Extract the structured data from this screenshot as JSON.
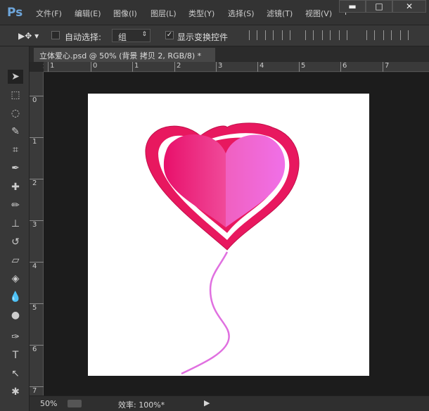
{
  "app": {
    "logo": "Ps"
  },
  "menu": [
    "文件(F)",
    "编辑(E)",
    "图像(I)",
    "图层(L)",
    "类型(Y)",
    "选择(S)",
    "滤镜(T)",
    "视图(V)",
    "i"
  ],
  "window_buttons": {
    "minimize": "▬",
    "maximize": "□",
    "close": "✕"
  },
  "options": {
    "auto_select_label": "自动选择:",
    "auto_select_checked": false,
    "auto_select_value": "组",
    "show_transform_label": "显示变换控件",
    "show_transform_checked": true
  },
  "document": {
    "tab_title": "立体爱心.psd @ 50% (背景 拷贝 2, RGB/8) *",
    "close": "×"
  },
  "rulers": {
    "top": [
      "1",
      "0",
      "1",
      "2",
      "3",
      "4",
      "5",
      "6",
      "7"
    ],
    "left": [
      "0",
      "1",
      "2",
      "3",
      "4",
      "5",
      "6",
      "7"
    ]
  },
  "status": {
    "zoom": "50%",
    "efficiency": "效率: 100%*"
  },
  "colors": {
    "heart_outer": "#e8185f",
    "heart_inner_left": "#f0207a",
    "heart_inner_right": "#f070e8",
    "string": "#e070e0"
  }
}
